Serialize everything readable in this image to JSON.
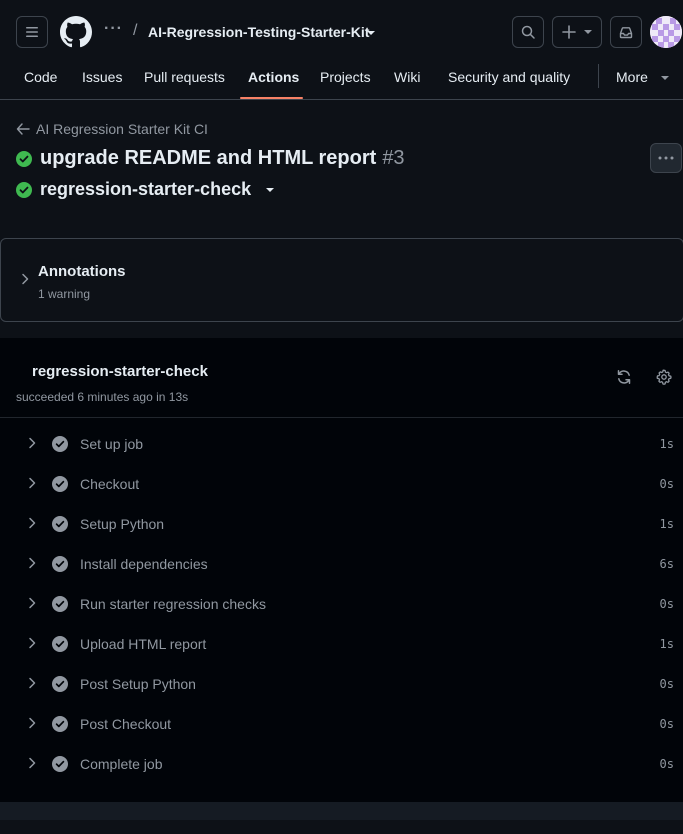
{
  "header": {
    "breadcrumb_dots": "···",
    "separator": "/",
    "repo_name": "AI-Regression-Testing-Starter-Kit",
    "icons": {
      "menu": "hamburger-icon",
      "logo": "github-logo",
      "search": "search-icon",
      "create": "plus-icon",
      "inbox": "inbox-icon",
      "avatar": "avatar"
    }
  },
  "nav": {
    "items": [
      {
        "label": "Code"
      },
      {
        "label": "Issues"
      },
      {
        "label": "Pull requests"
      },
      {
        "label": "Actions"
      },
      {
        "label": "Projects"
      },
      {
        "label": "Wiki"
      },
      {
        "label": "Security and quality"
      }
    ],
    "active": "Actions",
    "more_label": "More"
  },
  "run": {
    "workflow_name": "AI Regression Starter Kit CI",
    "title": "upgrade README and HTML report",
    "number": "#3",
    "job_name": "regression-starter-check"
  },
  "annotations": {
    "title": "Annotations",
    "summary": "1 warning"
  },
  "job": {
    "name": "regression-starter-check",
    "status_text": "succeeded 6 minutes ago in 13s",
    "steps": [
      {
        "name": "Set up job",
        "duration": "1s"
      },
      {
        "name": "Checkout",
        "duration": "0s"
      },
      {
        "name": "Setup Python",
        "duration": "1s"
      },
      {
        "name": "Install dependencies",
        "duration": "6s"
      },
      {
        "name": "Run starter regression checks",
        "duration": "0s"
      },
      {
        "name": "Upload HTML report",
        "duration": "1s"
      },
      {
        "name": "Post Setup Python",
        "duration": "0s"
      },
      {
        "name": "Post Checkout",
        "duration": "0s"
      },
      {
        "name": "Complete job",
        "duration": "0s"
      }
    ]
  },
  "colors": {
    "background": "#0d1117",
    "panel": "#010409",
    "border": "#3d444d",
    "text": "#e6edf3",
    "muted": "#9198a1",
    "success": "#3fb950",
    "active_underline": "#f78166"
  }
}
